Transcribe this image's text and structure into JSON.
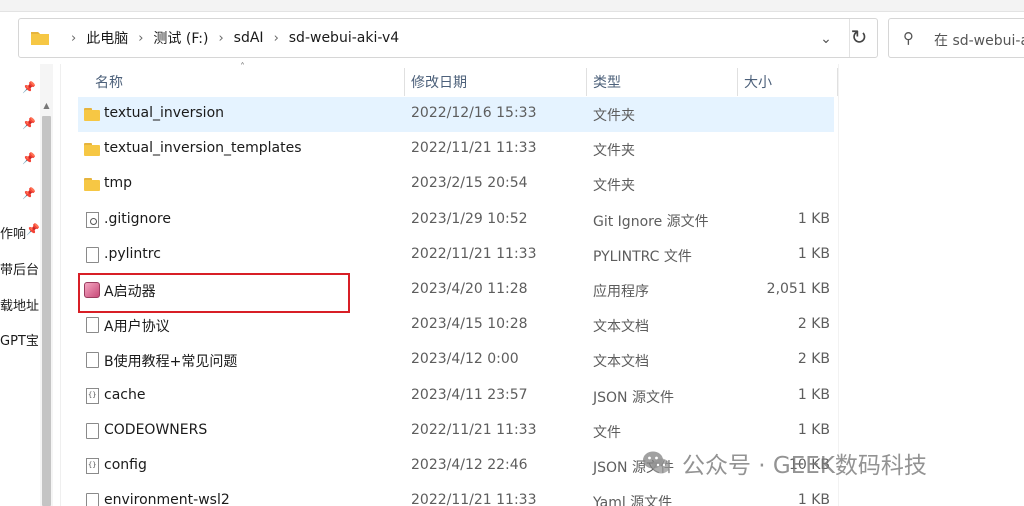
{
  "address": {
    "crumbs": [
      "此电脑",
      "测试 (F:)",
      "sdAI",
      "sd-webui-aki-v4"
    ]
  },
  "search": {
    "placeholder": "在 sd-webui-a"
  },
  "nav": {
    "items": [
      "作响",
      "带后台",
      "载地址",
      "GPT宝"
    ]
  },
  "columns": {
    "name": "名称",
    "date": "修改日期",
    "type": "类型",
    "size": "大小"
  },
  "files": [
    {
      "name": "textual_inversion",
      "date": "2022/12/16 15:33",
      "type": "文件夹",
      "size": "",
      "icon": "folder-icon"
    },
    {
      "name": "textual_inversion_templates",
      "date": "2022/11/21 11:33",
      "type": "文件夹",
      "size": "",
      "icon": "folder-icon"
    },
    {
      "name": "tmp",
      "date": "2023/2/15 20:54",
      "type": "文件夹",
      "size": "",
      "icon": "folder-icon"
    },
    {
      "name": ".gitignore",
      "date": "2023/1/29 10:52",
      "type": "Git Ignore 源文件",
      "size": "1 KB",
      "icon": "gear-file-icon"
    },
    {
      "name": ".pylintrc",
      "date": "2022/11/21 11:33",
      "type": "PYLINTRC 文件",
      "size": "1 KB",
      "icon": "file-icon"
    },
    {
      "name": "A启动器",
      "date": "2023/4/20 11:28",
      "type": "应用程序",
      "size": "2,051 KB",
      "icon": "app-icon"
    },
    {
      "name": "A用户协议",
      "date": "2023/4/15 10:28",
      "type": "文本文档",
      "size": "2 KB",
      "icon": "file-icon"
    },
    {
      "name": "B使用教程+常见问题",
      "date": "2023/4/12 0:00",
      "type": "文本文档",
      "size": "2 KB",
      "icon": "file-icon"
    },
    {
      "name": "cache",
      "date": "2023/4/11 23:57",
      "type": "JSON 源文件",
      "size": "1 KB",
      "icon": "json-file-icon"
    },
    {
      "name": "CODEOWNERS",
      "date": "2022/11/21 11:33",
      "type": "文件",
      "size": "1 KB",
      "icon": "file-icon"
    },
    {
      "name": "config",
      "date": "2023/4/12 22:46",
      "type": "JSON 源文件",
      "size": "10 KB",
      "icon": "json-file-icon"
    },
    {
      "name": "environment-wsl2",
      "date": "2022/11/21 11:33",
      "type": "Yaml 源文件",
      "size": "1 KB",
      "icon": "file-icon"
    }
  ],
  "selected_file": "textual_inversion",
  "highlighted_file": "A启动器",
  "watermark": "公众号 · GEEK数码科技",
  "colors": {
    "selection": "#e5f3ff",
    "highlight_border": "#d81f26",
    "folder": "#f6c744"
  }
}
